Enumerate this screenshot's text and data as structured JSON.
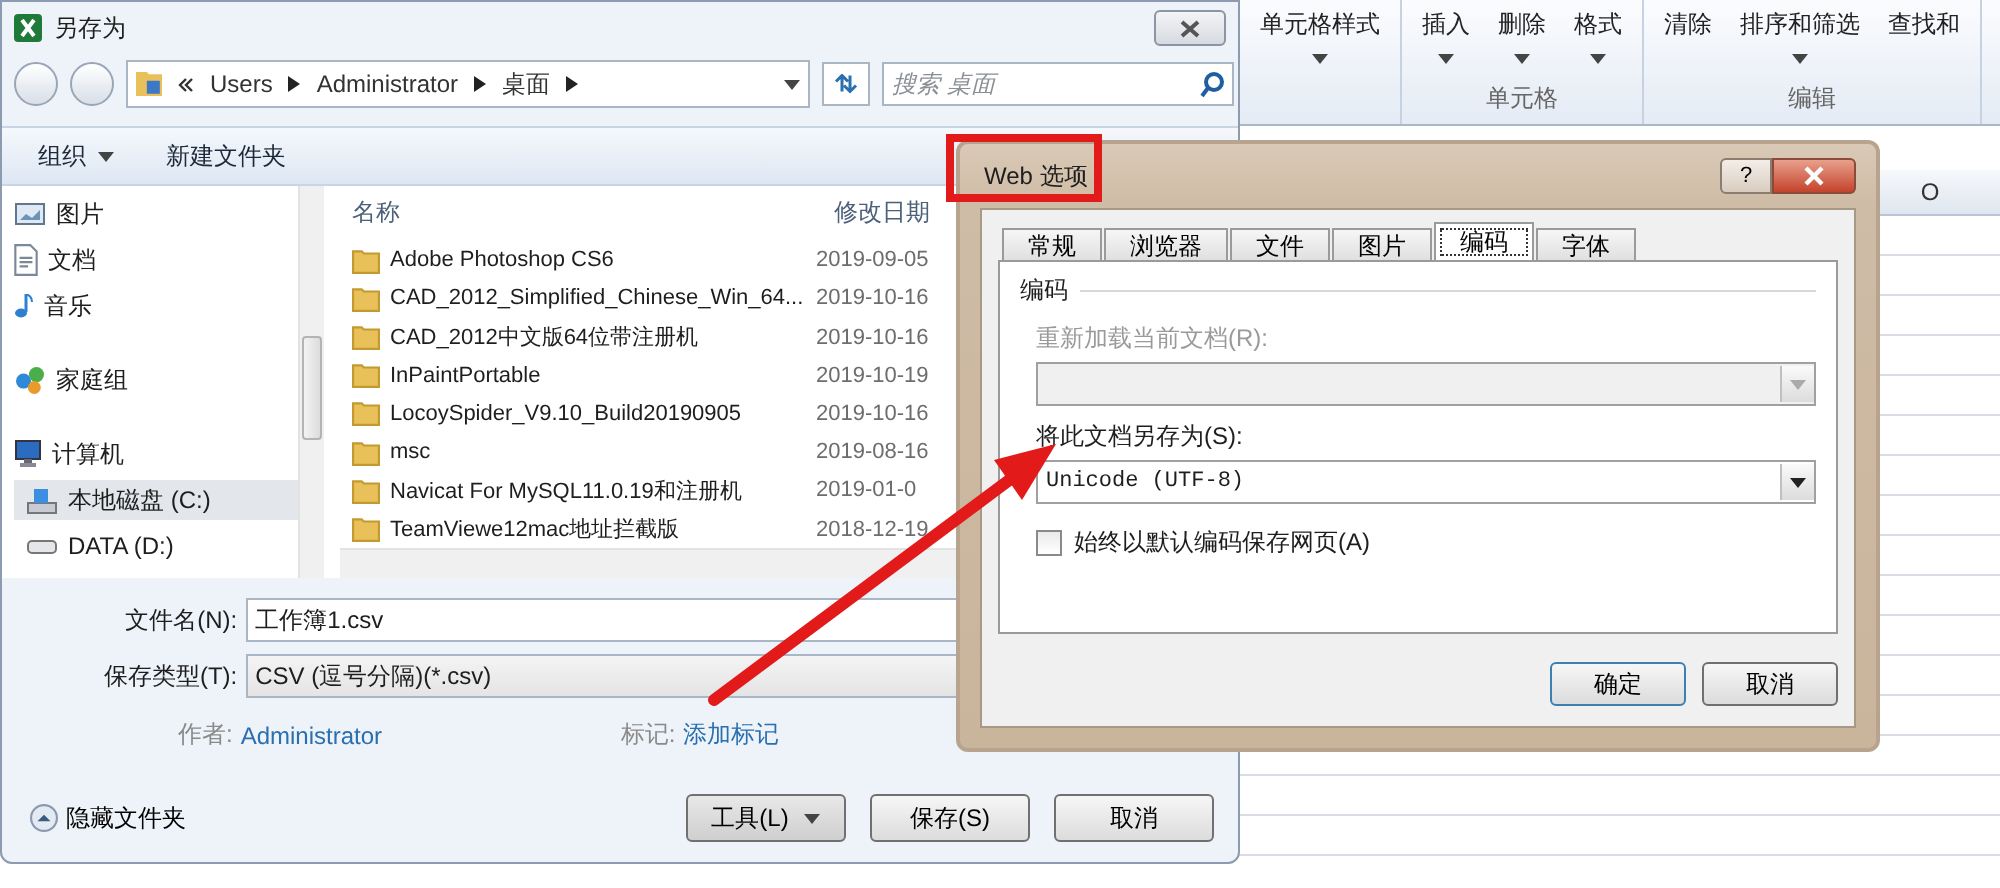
{
  "ribbon": {
    "cell_styles": "单元格样式",
    "cell_buttons": [
      "插入",
      "删除",
      "格式"
    ],
    "cells_label": "单元格",
    "clear": "清除",
    "sort_filter": "排序和筛选",
    "find_select": "查找和",
    "editing_label": "编辑"
  },
  "sheet": {
    "column_header": "O"
  },
  "save_dialog": {
    "title": "另存为",
    "breadcrumb": [
      "Users",
      "Administrator",
      "桌面"
    ],
    "search": {
      "placeholder": "搜索 桌面"
    },
    "toolbar": {
      "organize": "组织",
      "new_folder": "新建文件夹"
    },
    "sidebar": [
      {
        "label": "图片",
        "kind": "pictures",
        "selected": false
      },
      {
        "label": "文档",
        "kind": "documents",
        "selected": false
      },
      {
        "label": "音乐",
        "kind": "music",
        "selected": false
      },
      {
        "label": "家庭组",
        "kind": "homegroup",
        "selected": false
      },
      {
        "label": "计算机",
        "kind": "computer",
        "selected": false,
        "children": [
          {
            "label": "本地磁盘 (C:)",
            "kind": "disk",
            "selected": true
          },
          {
            "label": "DATA (D:)",
            "kind": "drive",
            "selected": false
          }
        ]
      }
    ],
    "columns": [
      "名称",
      "修改日期"
    ],
    "files": [
      {
        "name": "Adobe Photoshop CS6",
        "date": "2019-09-05"
      },
      {
        "name": "CAD_2012_Simplified_Chinese_Win_64...",
        "date": "2019-10-16"
      },
      {
        "name": "CAD_2012中文版64位带注册机",
        "date": "2019-10-16"
      },
      {
        "name": "InPaintPortable",
        "date": "2019-10-19"
      },
      {
        "name": "LocoySpider_V9.10_Build20190905",
        "date": "2019-10-16"
      },
      {
        "name": "msc",
        "date": "2019-08-16"
      },
      {
        "name": "Navicat For MySQL11.0.19和注册机",
        "date": "2019-01-0"
      },
      {
        "name": "TeamViewe12mac地址拦截版",
        "date": "2018-12-19"
      }
    ],
    "file_name": {
      "label": "文件名(N):",
      "value": "工作簿1.csv"
    },
    "file_type": {
      "label": "保存类型(T):",
      "value": "CSV (逗号分隔)(*.csv)"
    },
    "author": {
      "label": "作者:",
      "value": "Administrator"
    },
    "tags": {
      "label": "标记:",
      "value": "添加标记"
    },
    "hide_folders": "隐藏文件夹",
    "buttons": {
      "tools": "工具(L)",
      "save": "保存(S)",
      "cancel": "取消"
    }
  },
  "web_dialog": {
    "title": "Web 选项",
    "help": "?",
    "tabs": [
      {
        "label": "常规",
        "selected": false
      },
      {
        "label": "浏览器",
        "selected": false
      },
      {
        "label": "文件",
        "selected": false
      },
      {
        "label": "图片",
        "selected": false
      },
      {
        "label": "编码",
        "selected": true
      },
      {
        "label": "字体",
        "selected": false
      }
    ],
    "group_label": "编码",
    "reload": {
      "label": "重新加载当前文档(R):",
      "disabled": true
    },
    "save_as": {
      "label": "将此文档另存为(S):",
      "value": "Unicode (UTF-8)"
    },
    "always_default": {
      "label": "始终以默认编码保存网页(A)",
      "checked": false
    },
    "buttons": [
      "确定",
      "取消"
    ]
  }
}
